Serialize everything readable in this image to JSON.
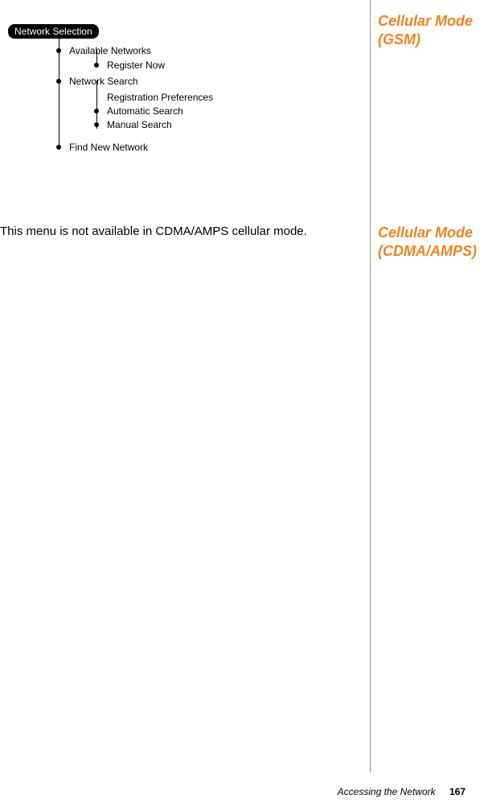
{
  "sidebar": {
    "heading1": "Cellular Mode (GSM)",
    "heading2": "Cellular Mode (CDMA/AMPS)"
  },
  "tree": {
    "badge": "Network Selection",
    "level1": {
      "item1": "Available Networks",
      "item1_sub1": "Register Now",
      "item2": "Network Search",
      "item2_sub1": "Registration Preferences",
      "item2_sub2": "Automatic Search",
      "item2_sub3": "Manual Search",
      "item3": "Find New Network"
    }
  },
  "body": {
    "paragraph": "This menu is not available in CDMA/AMPS cellular mode."
  },
  "footer": {
    "section": "Accessing the Network",
    "page": "167"
  }
}
